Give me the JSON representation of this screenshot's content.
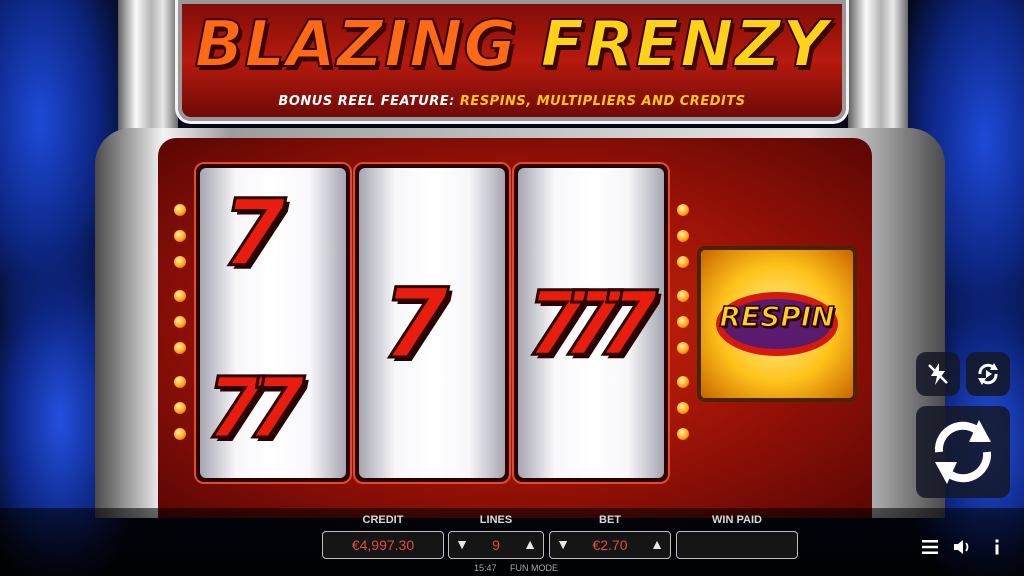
{
  "title": {
    "word1": "BLAZING",
    "word2": "FRENZY"
  },
  "subtitle": {
    "prefix": "BONUS REEL FEATURE:",
    "features": "RESPINS, MULTIPLIERS AND CREDITS"
  },
  "reels": [
    {
      "symbols": [
        "7",
        "77"
      ]
    },
    {
      "symbols": [
        "7"
      ]
    },
    {
      "symbols": [
        "777"
      ]
    }
  ],
  "bonus_reel": {
    "label": "RESPIN"
  },
  "panel": {
    "credit": {
      "label": "CREDIT",
      "value": "€4,997.30"
    },
    "lines": {
      "label": "LINES",
      "value": "9"
    },
    "bet": {
      "label": "BET",
      "value": "€2.70"
    },
    "win": {
      "label": "WIN PAID",
      "value": ""
    }
  },
  "status": {
    "time": "15:47",
    "mode": "FUN MODE"
  },
  "icons": {
    "turbo": "lightning-off-icon",
    "autoplay": "autoplay-icon",
    "spin": "spin-icon",
    "menu": "menu-icon",
    "sound": "speaker-icon",
    "info": "info-icon"
  },
  "colors": {
    "value_text": "#e74c3c",
    "title_yellow": "#ffd21a",
    "title_orange": "#ff6a16"
  }
}
